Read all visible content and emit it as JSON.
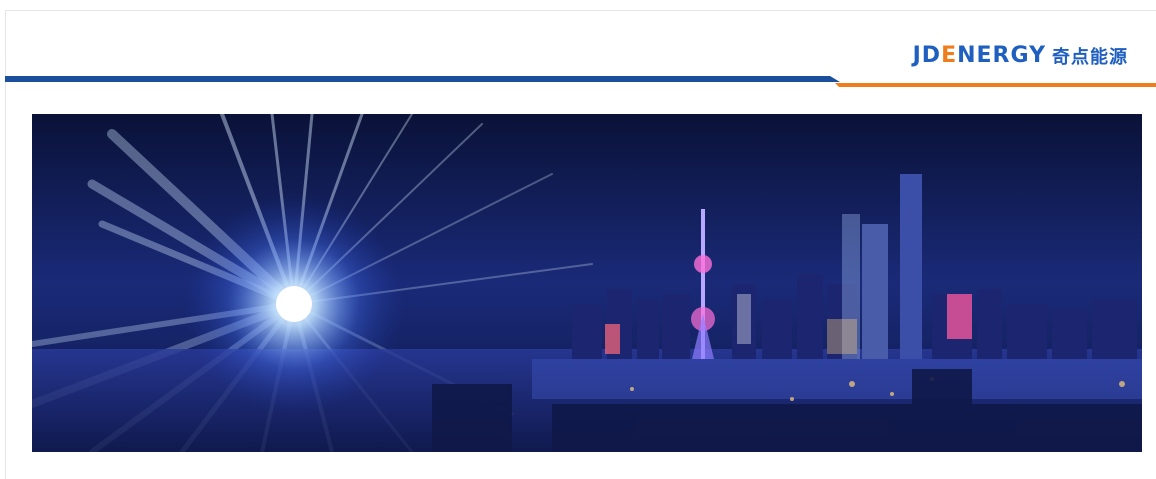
{
  "header": {
    "logo": {
      "mark_jd": "JD",
      "mark_e": "E",
      "mark_nergy": "NERGY",
      "chinese_name": "奇点能源"
    }
  },
  "colors": {
    "brand_blue": "#1f5fbf",
    "brand_orange": "#f07d1b",
    "banner_bg": "#0b1440"
  },
  "banner": {
    "image": "city-skyline-night-light-burst"
  }
}
